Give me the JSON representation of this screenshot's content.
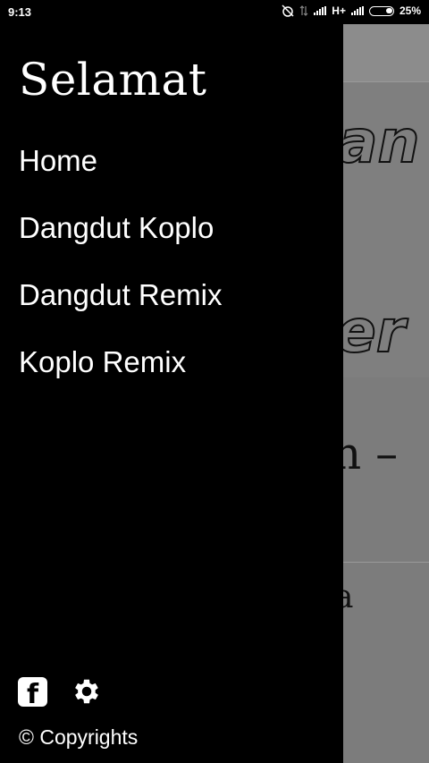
{
  "status_bar": {
    "time": "9:13",
    "network": "H+",
    "battery": "25%"
  },
  "background": {
    "banner_line1": "an",
    "banner_line2": "er",
    "card1_text": "h –",
    "card2_text": "a"
  },
  "drawer": {
    "title": "Selamat",
    "items": [
      {
        "label": "Home"
      },
      {
        "label": "Dangdut Koplo"
      },
      {
        "label": "Dangdut Remix"
      },
      {
        "label": "Koplo Remix"
      }
    ],
    "footer": {
      "facebook_icon": "facebook-icon",
      "settings_icon": "gear-icon",
      "copyright": "© Copyrights"
    }
  }
}
